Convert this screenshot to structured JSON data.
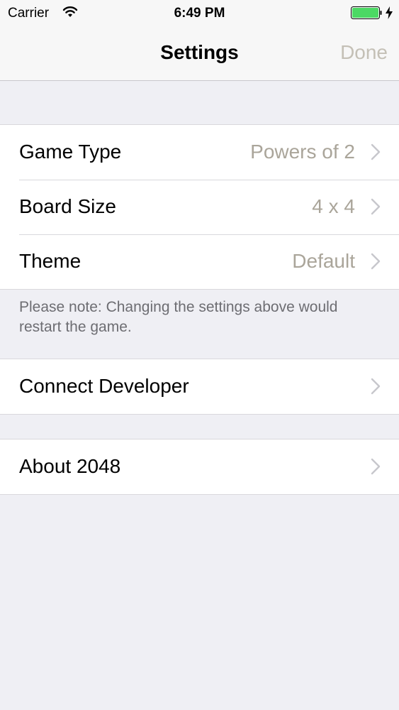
{
  "status_bar": {
    "carrier": "Carrier",
    "time": "6:49 PM",
    "battery_color": "#4cd964"
  },
  "nav": {
    "title": "Settings",
    "done_label": "Done"
  },
  "settings_group": {
    "rows": [
      {
        "label": "Game Type",
        "value": "Powers of 2"
      },
      {
        "label": "Board Size",
        "value": "4 x 4"
      },
      {
        "label": "Theme",
        "value": "Default"
      }
    ],
    "footer": "Please note: Changing the settings above would restart the game."
  },
  "developer_group": {
    "label": "Connect Developer"
  },
  "about_group": {
    "label": "About 2048"
  },
  "colors": {
    "background": "#efeff4",
    "done_disabled": "#c4c0b6",
    "value_text": "#aaa59a",
    "chevron": "#c7c7cc"
  }
}
